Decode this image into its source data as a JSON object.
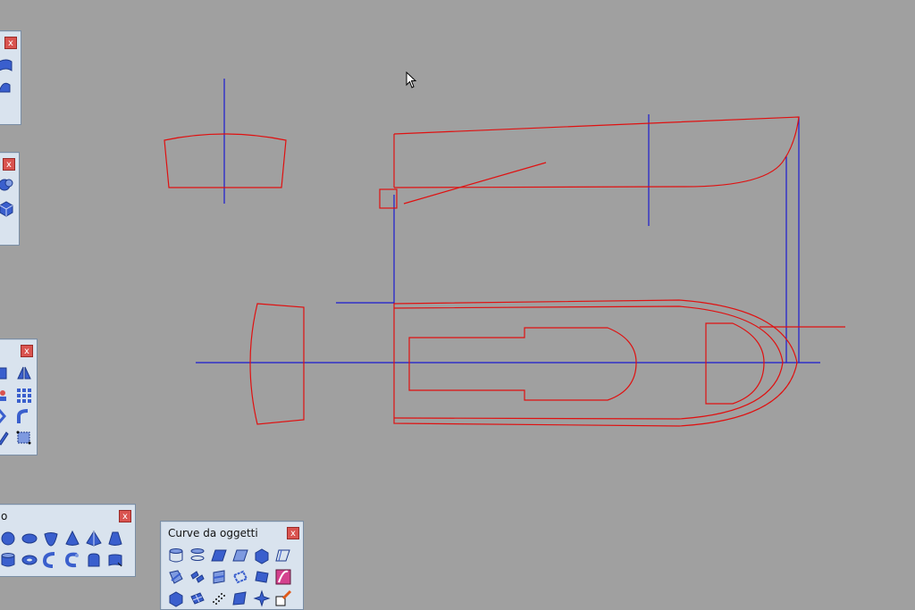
{
  "app": {
    "background_color": "#a0a0a0",
    "curve_color": "#e01010",
    "axis_color": "#1a1ad0"
  },
  "palettes": {
    "curve_from_objects": {
      "title": "Curve da oggetti",
      "close_label": "x"
    },
    "solids": {
      "title_fragment": "o",
      "close_label": "x"
    },
    "left_1": {
      "close_label": "x"
    },
    "left_2": {
      "close_label": "x"
    },
    "left_3": {
      "close_label": "x"
    }
  }
}
